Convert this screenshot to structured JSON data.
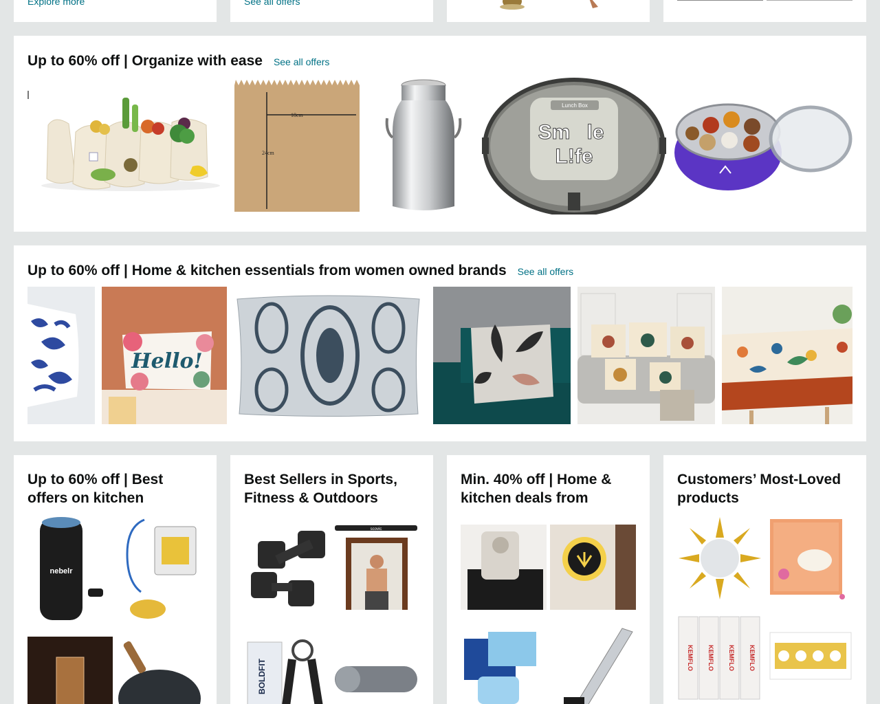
{
  "top_cards": [
    {
      "link": "Explore more"
    },
    {
      "link": "See all offers"
    },
    {
      "link": ""
    },
    {
      "link": ""
    }
  ],
  "organize": {
    "title": "Up to 60% off | Organize with ease",
    "link": "See all offers",
    "products": [
      {
        "name": "mesh produce bags with vegetables"
      },
      {
        "name": "brown paper bag",
        "dim_width": "18cm",
        "dim_height": "24cm"
      },
      {
        "name": "steel milk can"
      },
      {
        "name": "lunch box",
        "brand_line1": "Sm",
        "brand_line2": "le",
        "brand_line3": "L!fe",
        "lid_label": "Lunch Box"
      },
      {
        "name": "spice box masala dabba"
      }
    ]
  },
  "women": {
    "title": "Up to 60% off | Home & kitchen essentials from women owned brands",
    "link": "See all offers",
    "products": [
      {
        "name": "blue ikat cushion cover"
      },
      {
        "name": "hello floral cushion",
        "text": "Hello!"
      },
      {
        "name": "damask cushion cover"
      },
      {
        "name": "leaf print cushion on sofa"
      },
      {
        "name": "set of floral cushions"
      },
      {
        "name": "bird print tablecloth"
      }
    ]
  },
  "bottom": [
    {
      "title": "Up to 60% off | Best offers on kitchen",
      "items": [
        {
          "label": "nebelr"
        },
        {
          "label": "oil pump"
        },
        {
          "label": "glass"
        },
        {
          "label": "tawa"
        }
      ]
    },
    {
      "title": "Best Sellers in Sports, Fitness & Outdoors",
      "items": [
        {
          "label": "dumbbells"
        },
        {
          "label": "pull-up bar",
          "bar_text": "scovic"
        },
        {
          "label": "hand gripper",
          "brand": "BOLDFIT"
        },
        {
          "label": "yoga mat"
        }
      ]
    },
    {
      "title": "Min. 40% off | Home & kitchen deals from",
      "items": [
        {
          "label": "coffee machine"
        },
        {
          "label": "wall lamp"
        },
        {
          "label": "face masks"
        },
        {
          "label": "crinkle cutter"
        }
      ]
    },
    {
      "title": "Customers’ Most-Loved products",
      "items": [
        {
          "label": "sun mirror"
        },
        {
          "label": "gift box"
        },
        {
          "label": "kemflo rolls",
          "brand": "KEMFLO"
        },
        {
          "label": "golden border"
        }
      ]
    }
  ]
}
